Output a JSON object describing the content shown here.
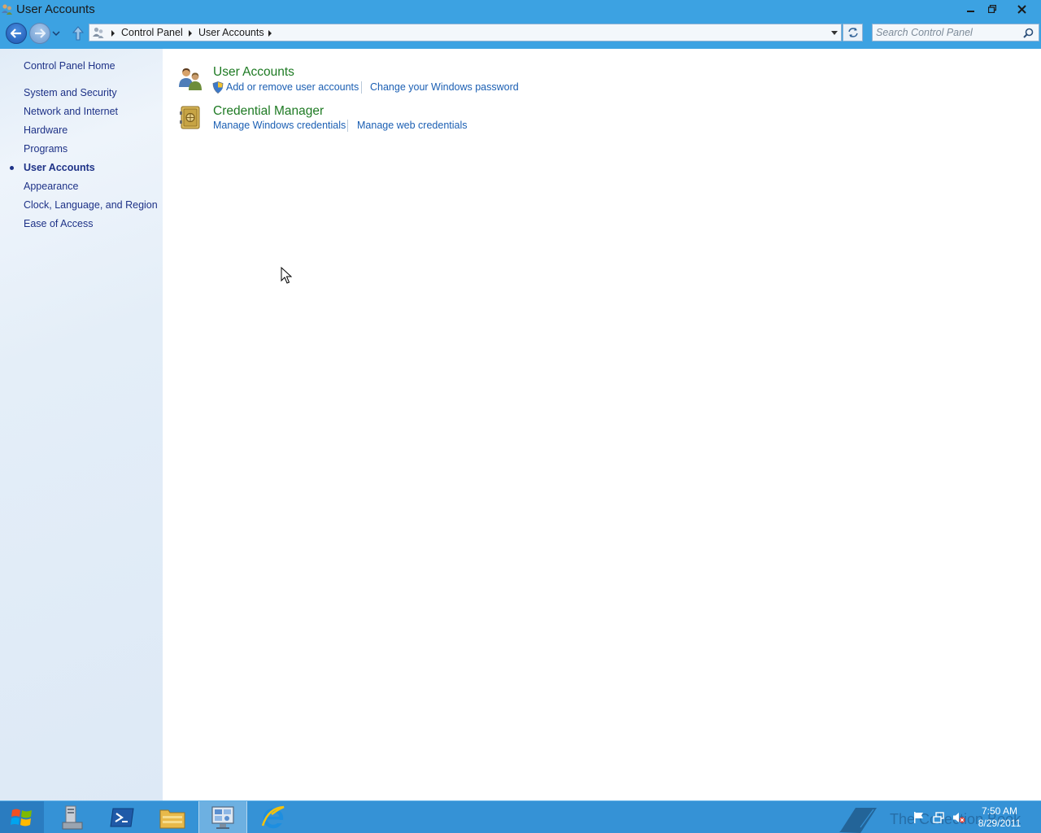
{
  "window": {
    "title": "User Accounts",
    "controls": {
      "minimize": "minimize",
      "restore": "restore",
      "close": "close"
    }
  },
  "navigation": {
    "breadcrumbs": [
      "Control Panel",
      "User Accounts"
    ],
    "search": {
      "placeholder": "Search Control Panel",
      "value": ""
    }
  },
  "sidebar": {
    "items": [
      {
        "label": "Control Panel Home",
        "active": false
      },
      {
        "label": "System and Security",
        "active": false
      },
      {
        "label": "Network and Internet",
        "active": false
      },
      {
        "label": "Hardware",
        "active": false
      },
      {
        "label": "Programs",
        "active": false
      },
      {
        "label": "User Accounts",
        "active": true
      },
      {
        "label": "Appearance",
        "active": false
      },
      {
        "label": "Clock, Language, and Region",
        "active": false
      },
      {
        "label": "Ease of Access",
        "active": false
      }
    ]
  },
  "categories": [
    {
      "title": "User Accounts",
      "icon": "users-icon",
      "links": [
        "Add or remove user accounts",
        "Change your Windows password"
      ]
    },
    {
      "title": "Credential Manager",
      "icon": "vault-icon",
      "links": [
        "Manage Windows credentials",
        "Manage web credentials"
      ]
    }
  ],
  "taskbar": {
    "apps": [
      "server-manager-icon",
      "powershell-icon",
      "file-explorer-icon",
      "control-panel-icon",
      "internet-explorer-icon"
    ],
    "active_app": "control-panel-icon",
    "watermark": "The Collection Book",
    "tray_icons": [
      "flag-icon",
      "network-icon",
      "speaker-muted-icon"
    ],
    "time": "7:50 AM",
    "date": "8/29/2011"
  },
  "colors": {
    "titlebar": "#3ca2e2",
    "taskbar": "#3592d6",
    "link": "#1b5fb3",
    "category_title": "#1e7a23",
    "sidebar_text": "#1e3287"
  }
}
